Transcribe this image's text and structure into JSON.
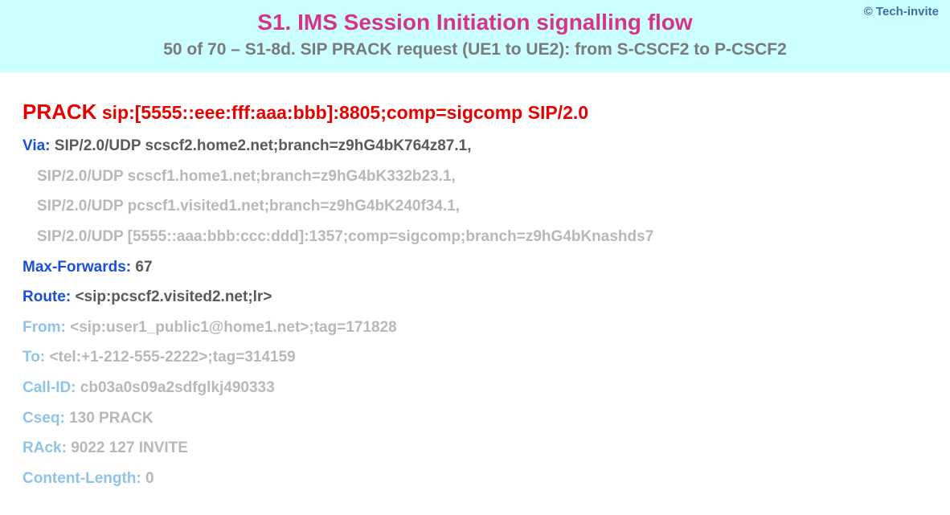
{
  "copyright": "© Tech-invite",
  "title": "S1. IMS Session Initiation signalling flow",
  "subtitle": "50 of 70 – S1-8d. SIP PRACK request (UE1 to UE2): from S-CSCF2 to P-CSCF2",
  "request": {
    "method": "PRACK",
    "uri": "sip:[5555::eee:fff:aaa:bbb]:8805;comp=sigcomp SIP/2.0"
  },
  "headers": {
    "via": {
      "name": "Via:",
      "first": "SIP/2.0/UDP scscf2.home2.net;branch=z9hG4bK764z87.1,",
      "cont1": "SIP/2.0/UDP scscf1.home1.net;branch=z9hG4bK332b23.1,",
      "cont2": "SIP/2.0/UDP pcscf1.visited1.net;branch=z9hG4bK240f34.1,",
      "cont3": "SIP/2.0/UDP [5555::aaa:bbb:ccc:ddd]:1357;comp=sigcomp;branch=z9hG4bKnashds7"
    },
    "maxforwards": {
      "name": "Max-Forwards:",
      "value": "67"
    },
    "route": {
      "name": "Route:",
      "value": "<sip:pcscf2.visited2.net;lr>"
    },
    "from": {
      "name": "From:",
      "value": "<sip:user1_public1@home1.net>;tag=171828"
    },
    "to": {
      "name": "To:",
      "value": "<tel:+1-212-555-2222>;tag=314159"
    },
    "callid": {
      "name": "Call-ID:",
      "value": "cb03a0s09a2sdfglkj490333"
    },
    "cseq": {
      "name": "Cseq:",
      "value": "130 PRACK"
    },
    "rack": {
      "name": "RAck:",
      "value": "9022 127 INVITE"
    },
    "contentlength": {
      "name": "Content-Length:",
      "value": "0"
    }
  }
}
